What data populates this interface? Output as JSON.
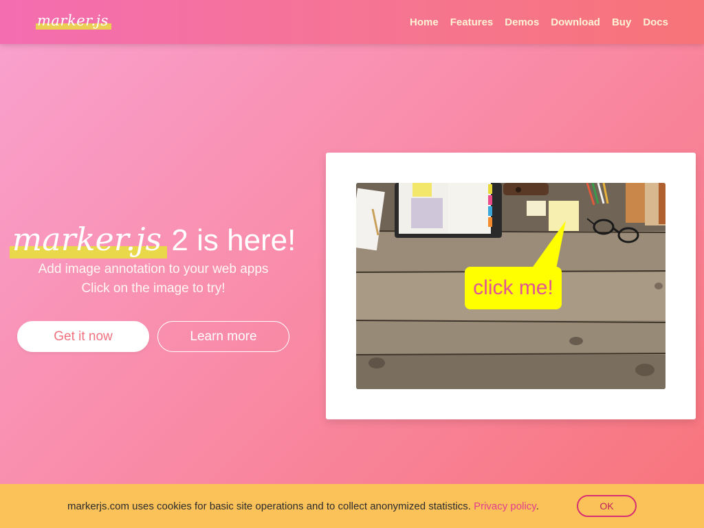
{
  "brand": {
    "logo_text": "marker.js"
  },
  "nav": {
    "items": [
      {
        "label": "Home"
      },
      {
        "label": "Features"
      },
      {
        "label": "Demos"
      },
      {
        "label": "Download"
      },
      {
        "label": "Buy"
      },
      {
        "label": "Docs"
      }
    ]
  },
  "hero": {
    "title_brand": "marker.js",
    "title_rest": " 2 is here!",
    "subtitle_line1": "Add image annotation to your web apps",
    "subtitle_line2": "Click on the image to try!",
    "primary_button": "Get it now",
    "secondary_button": "Learn more"
  },
  "demo": {
    "callout_text": "click me!",
    "callout_color": "#ffff00",
    "callout_text_color": "#e05596"
  },
  "cookie_banner": {
    "message": "markerjs.com uses cookies for basic site operations and to collect anonymized statistics. ",
    "link_text": "Privacy policy",
    "suffix": ".",
    "button_label": "OK"
  },
  "colors": {
    "accent_yellow": "#e9d94a",
    "cookie_bg": "#fcc25a",
    "link_pink": "#e23d8f"
  }
}
